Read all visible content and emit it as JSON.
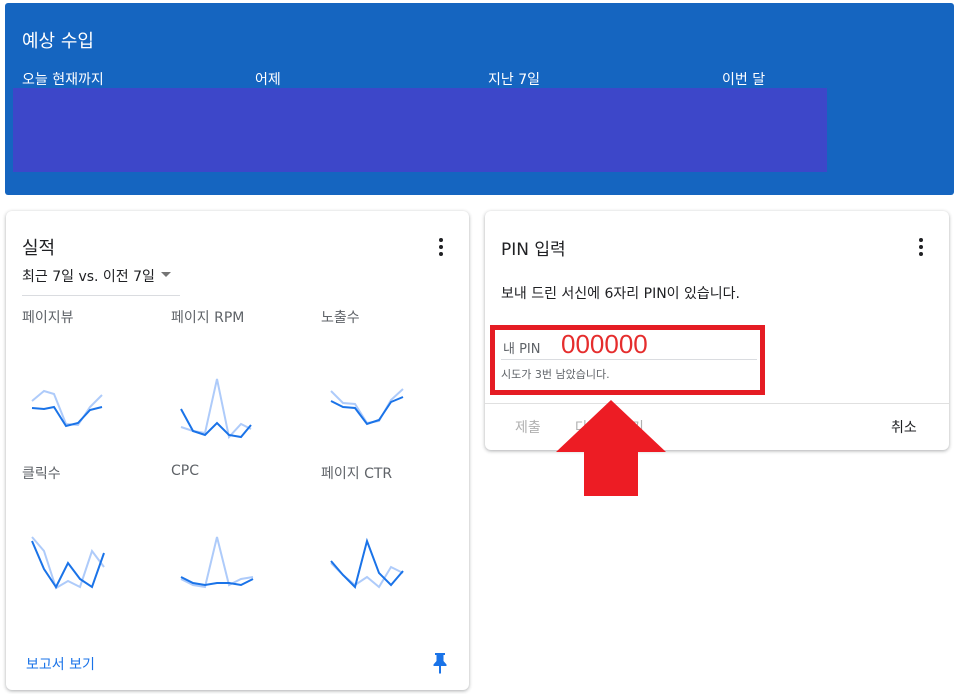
{
  "earnings": {
    "title": "예상 수입",
    "columns": [
      "오늘 현재까지",
      "어제",
      "지난 7일",
      "이번 달"
    ]
  },
  "performance": {
    "title": "실적",
    "range_label": "최근 7일 vs. 이전 7일",
    "metrics": [
      {
        "label": "페이지뷰"
      },
      {
        "label": "페이지 RPM"
      },
      {
        "label": "노출수"
      },
      {
        "label": "클릭수"
      },
      {
        "label": "CPC"
      },
      {
        "label": "페이지 CTR"
      }
    ],
    "report_link": "보고서 보기",
    "colors": {
      "current": "#1a73e8",
      "previous": "#aecbfa"
    }
  },
  "pin": {
    "title": "PIN 입력",
    "description": "보내 드린 서신에 6자리 PIN이 있습니다.",
    "field_label": "내 PIN",
    "value": "000000",
    "hint": "시도가 3번 남았습니다.",
    "submit_label": "제출",
    "resend_label": "다시 보내기",
    "cancel_label": "취소"
  },
  "colors": {
    "banner": "#1565c0",
    "highlight": "#e51c23",
    "arrow": "#ed1c24"
  }
}
